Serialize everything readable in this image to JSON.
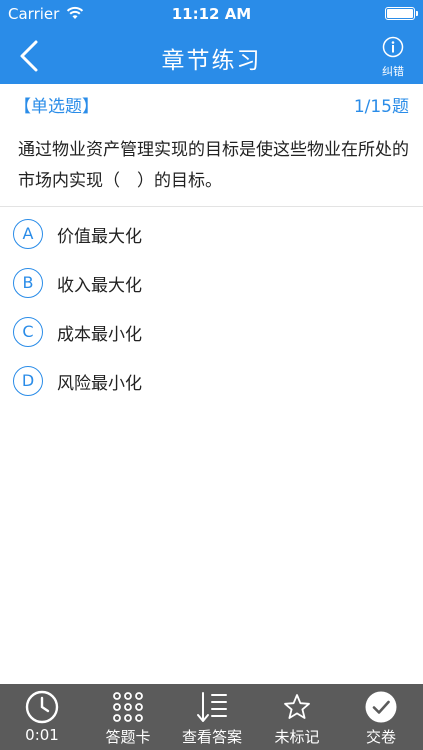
{
  "status_bar": {
    "carrier": "Carrier",
    "time": "11:12 AM"
  },
  "nav": {
    "title": "章节练习",
    "report_label": "纠错"
  },
  "question_header": {
    "type_label": "【单选题】",
    "progress": "1/15题"
  },
  "question": {
    "text": "通过物业资产管理实现的目标是使这些物业在所处的市场内实现（　）的目标。"
  },
  "options": [
    {
      "letter": "A",
      "text": "价值最大化"
    },
    {
      "letter": "B",
      "text": "收入最大化"
    },
    {
      "letter": "C",
      "text": "成本最小化"
    },
    {
      "letter": "D",
      "text": "风险最小化"
    }
  ],
  "tab_bar": {
    "timer": "0:01",
    "answer_card": "答题卡",
    "view_answer": "查看答案",
    "bookmark": "未标记",
    "submit": "交卷"
  },
  "colors": {
    "accent": "#2a8ce8",
    "tab_bar_bg": "#5b5b5b"
  }
}
